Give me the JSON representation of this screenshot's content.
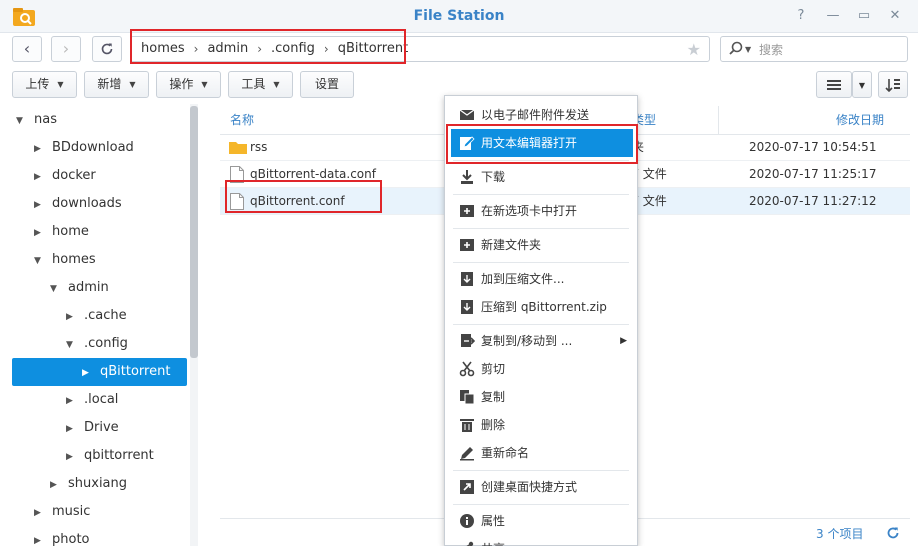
{
  "window": {
    "title": "File Station"
  },
  "nav": {
    "breadcrumbs": [
      "homes",
      "admin",
      ".config",
      "qBittorrent"
    ],
    "search_placeholder": "搜索"
  },
  "toolbar": {
    "upload": "上传",
    "create": "新增",
    "action": "操作",
    "tools": "工具",
    "settings": "设置"
  },
  "sidebar": {
    "items": [
      {
        "label": "nas",
        "level": 0,
        "expanded": true
      },
      {
        "label": "BDdownload",
        "level": 1,
        "expanded": false
      },
      {
        "label": "docker",
        "level": 1,
        "expanded": false
      },
      {
        "label": "downloads",
        "level": 1,
        "expanded": false
      },
      {
        "label": "home",
        "level": 1,
        "expanded": false
      },
      {
        "label": "homes",
        "level": 1,
        "expanded": true
      },
      {
        "label": "admin",
        "level": 2,
        "expanded": true
      },
      {
        "label": ".cache",
        "level": 3,
        "expanded": false
      },
      {
        "label": ".config",
        "level": 3,
        "expanded": true
      },
      {
        "label": "qBittorrent",
        "level": 4,
        "expanded": false,
        "selected": true
      },
      {
        "label": ".local",
        "level": 3,
        "expanded": false
      },
      {
        "label": "Drive",
        "level": 3,
        "expanded": false
      },
      {
        "label": "qbittorrent",
        "level": 3,
        "expanded": false
      },
      {
        "label": "shuxiang",
        "level": 2,
        "expanded": false
      },
      {
        "label": "music",
        "level": 1,
        "expanded": false
      },
      {
        "label": "photo",
        "level": 1,
        "expanded": false
      }
    ]
  },
  "file_list": {
    "columns": {
      "name": "名称",
      "type": "类型",
      "modified": "修改日期"
    },
    "rows": [
      {
        "name": "rss",
        "type": "夹",
        "modified": "2020-07-17 10:54:51",
        "kind": "folder"
      },
      {
        "name": "qBittorrent-data.conf",
        "type": "F 文件",
        "modified": "2020-07-17 11:25:17",
        "kind": "file"
      },
      {
        "name": "qBittorrent.conf",
        "type": "F 文件",
        "modified": "2020-07-17 11:27:12",
        "kind": "file",
        "selected": true
      }
    ],
    "count": "3 个项目"
  },
  "context_menu": {
    "items": [
      {
        "label": "以电子邮件附件发送",
        "icon": "mail-icon"
      },
      {
        "label": "用文本编辑器打开",
        "icon": "edit-icon",
        "active": true
      },
      {
        "label": "下载",
        "icon": "download-icon"
      },
      {
        "label": "在新选项卡中打开",
        "icon": "new-tab-icon"
      },
      {
        "label": "新建文件夹",
        "icon": "new-folder-icon"
      },
      {
        "label": "加到压缩文件...",
        "icon": "compress-icon"
      },
      {
        "label": "压缩到 qBittorrent.zip",
        "icon": "zip-icon"
      },
      {
        "label": "复制到/移动到 ...",
        "icon": "copy-move-icon",
        "submenu": true
      },
      {
        "label": "剪切",
        "icon": "cut-icon"
      },
      {
        "label": "复制",
        "icon": "copy-icon"
      },
      {
        "label": "删除",
        "icon": "trash-icon"
      },
      {
        "label": "重新命名",
        "icon": "rename-icon"
      },
      {
        "label": "创建桌面快捷方式",
        "icon": "shortcut-icon"
      },
      {
        "label": "属性",
        "icon": "info-icon"
      },
      {
        "label": "共享",
        "icon": "share-icon"
      }
    ]
  },
  "colors": {
    "accent": "#0e8fe0",
    "title": "#3a83c7",
    "highlight_box": "#e0262a"
  }
}
